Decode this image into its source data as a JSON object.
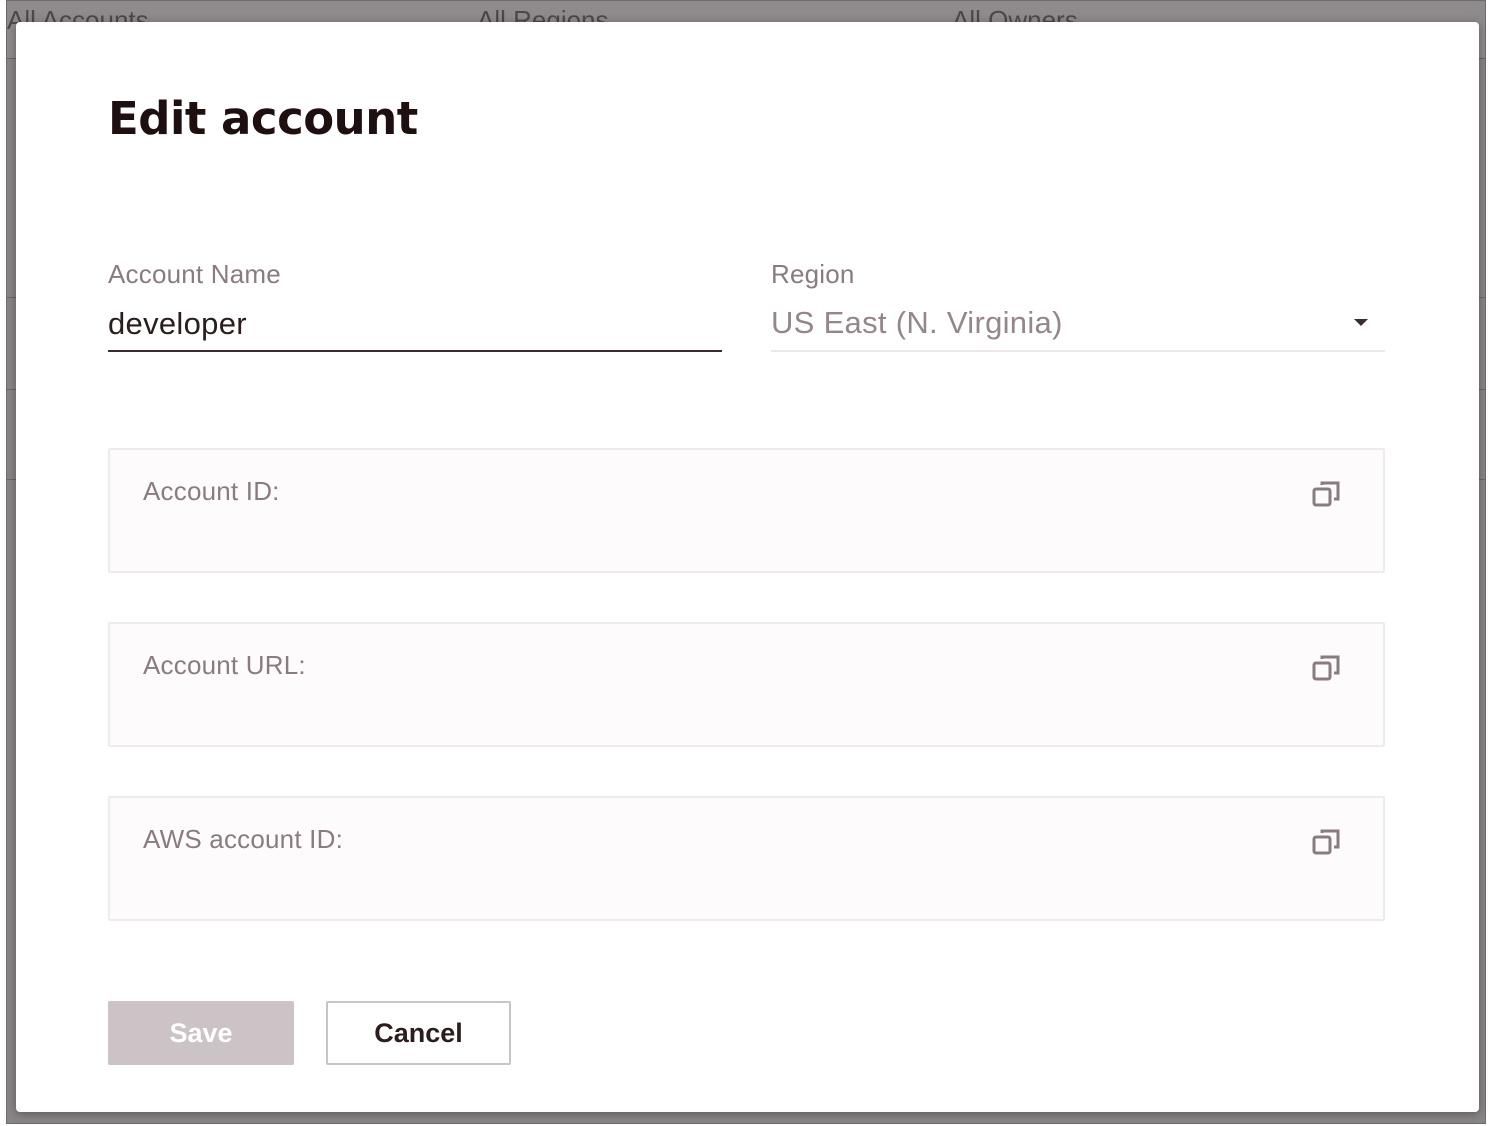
{
  "background": {
    "header_items": [
      "All Accounts",
      "All Regions",
      "All Owners"
    ]
  },
  "dialog": {
    "title": "Edit account",
    "account_name": {
      "label": "Account Name",
      "value": "developer"
    },
    "region": {
      "label": "Region",
      "value": "US East (N. Virginia)"
    },
    "cards": [
      {
        "label": "Account ID:",
        "value": "",
        "copy_icon": "copy-icon"
      },
      {
        "label": "Account URL:",
        "value": "",
        "copy_icon": "copy-icon"
      },
      {
        "label": "AWS account ID:",
        "value": "",
        "copy_icon": "copy-icon"
      }
    ],
    "buttons": {
      "save": "Save",
      "cancel": "Cancel"
    }
  },
  "colors": {
    "title": "#1e0f10",
    "label": "#8a7c7e",
    "button_disabled": "#cbc3c5",
    "backdrop": "#8a8688"
  }
}
